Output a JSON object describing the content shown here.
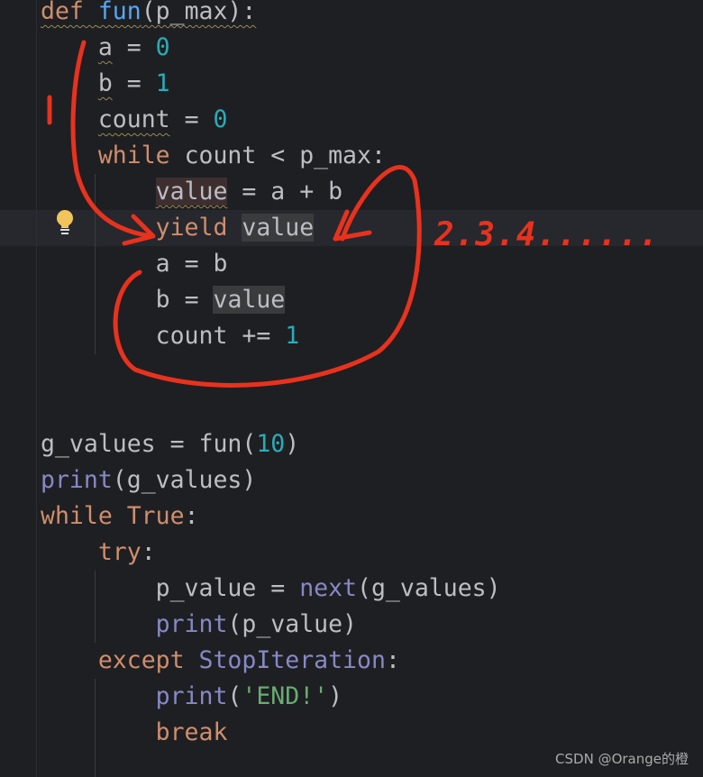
{
  "colors": {
    "background": "#1e1f22",
    "keyword": "#cf8e6d",
    "function": "#56a8f5",
    "number": "#2aacb8",
    "builtin": "#8888c6",
    "string": "#6aab73",
    "text": "#bcbec4",
    "annotation": "#e8321e"
  },
  "code_lines": [
    [
      [
        "kw",
        "def "
      ],
      [
        "fn",
        "fun"
      ],
      [
        "df",
        "(p_max):"
      ]
    ],
    [
      [
        "df",
        "    "
      ],
      [
        "df",
        "a"
      ],
      [
        "df",
        " = "
      ],
      [
        "num",
        "0"
      ]
    ],
    [
      [
        "df",
        "    "
      ],
      [
        "df",
        "b"
      ],
      [
        "df",
        " = "
      ],
      [
        "num",
        "1"
      ]
    ],
    [
      [
        "df",
        "    "
      ],
      [
        "df",
        "count"
      ],
      [
        "df",
        " = "
      ],
      [
        "num",
        "0"
      ]
    ],
    [
      [
        "df",
        "    "
      ],
      [
        "kw",
        "while"
      ],
      [
        "df",
        " count < p_max:"
      ]
    ],
    [
      [
        "df",
        "        "
      ],
      [
        "hlw",
        "value"
      ],
      [
        "df",
        " = a + b"
      ]
    ],
    [
      [
        "df",
        "        "
      ],
      [
        "kw",
        "yield"
      ],
      [
        "df",
        " "
      ],
      [
        "hl",
        "value"
      ]
    ],
    [
      [
        "df",
        "        "
      ],
      [
        "df",
        "a"
      ],
      [
        "df",
        " = b"
      ]
    ],
    [
      [
        "df",
        "        "
      ],
      [
        "df",
        "b"
      ],
      [
        "df",
        " = "
      ],
      [
        "hl",
        "value"
      ]
    ],
    [
      [
        "df",
        "        count += "
      ],
      [
        "num",
        "1"
      ]
    ],
    [],
    [],
    [
      [
        "df",
        "g_values = fun("
      ],
      [
        "num",
        "10"
      ],
      [
        "df",
        ")"
      ]
    ],
    [
      [
        "bi",
        "print"
      ],
      [
        "df",
        "(g_values)"
      ]
    ],
    [
      [
        "kw",
        "while True"
      ],
      [
        "df",
        ":"
      ]
    ],
    [
      [
        "df",
        "    "
      ],
      [
        "kw",
        "try"
      ],
      [
        "df",
        ":"
      ]
    ],
    [
      [
        "df",
        "        p_value = "
      ],
      [
        "bi",
        "next"
      ],
      [
        "df",
        "(g_values)"
      ]
    ],
    [
      [
        "df",
        "        "
      ],
      [
        "bi",
        "print"
      ],
      [
        "df",
        "(p_value)"
      ]
    ],
    [
      [
        "df",
        "    "
      ],
      [
        "kw",
        "except "
      ],
      [
        "bi",
        "StopIteration"
      ],
      [
        "df",
        ":"
      ]
    ],
    [
      [
        "df",
        "        "
      ],
      [
        "bi",
        "print"
      ],
      [
        "df",
        "("
      ],
      [
        "str",
        "'END!'"
      ],
      [
        "df",
        ")"
      ]
    ],
    [
      [
        "df",
        "        "
      ],
      [
        "kw",
        "break"
      ]
    ]
  ],
  "warned_tokens": [
    [
      0,
      0
    ],
    [
      0,
      1
    ],
    [
      0,
      2
    ],
    [
      1,
      1
    ],
    [
      2,
      1
    ],
    [
      3,
      1
    ],
    [
      5,
      1
    ]
  ],
  "current_line": 6,
  "annotations": {
    "label_1": "1",
    "label_2": "2.3.4......"
  },
  "watermark": "CSDN @Orange的橙",
  "icons": {
    "gutter": "lightbulb-icon"
  }
}
